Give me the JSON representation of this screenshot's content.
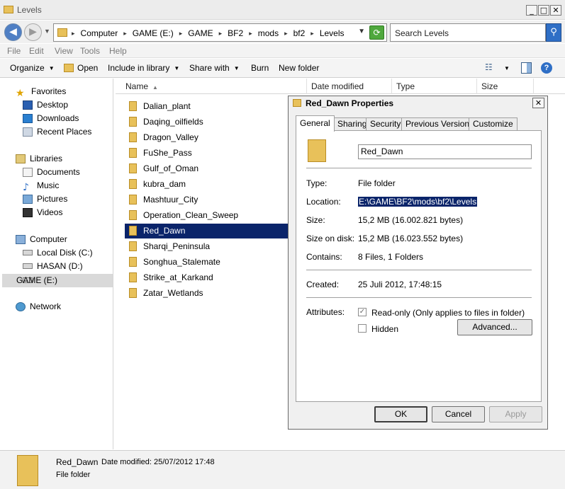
{
  "window": {
    "title": "Levels",
    "controls": {
      "minimize": "_",
      "maximize": "□",
      "close": "✕"
    }
  },
  "address": {
    "crumbs": [
      "Computer",
      "GAME (E:)",
      "GAME",
      "BF2",
      "mods",
      "bf2",
      "Levels"
    ],
    "search_placeholder": "Search Levels"
  },
  "menu": [
    "File",
    "Edit",
    "View",
    "Tools",
    "Help"
  ],
  "toolbar": {
    "organize": "Organize",
    "open": "Open",
    "include_in_library": "Include in library",
    "share_with": "Share with",
    "burn": "Burn",
    "new_folder": "New folder"
  },
  "nav": {
    "favorites": "Favorites",
    "desktop": "Desktop",
    "downloads": "Downloads",
    "recent_places": "Recent Places",
    "libraries": "Libraries",
    "documents": "Documents",
    "music": "Music",
    "pictures": "Pictures",
    "videos": "Videos",
    "computer": "Computer",
    "local_disk": "Local Disk (C:)",
    "hasan": "HASAN (D:)",
    "game": "GAME (E:)",
    "network": "Network"
  },
  "columns": {
    "name": "Name",
    "date_modified": "Date modified",
    "type": "Type",
    "size": "Size"
  },
  "files": [
    "Dalian_plant",
    "Daqing_oilfields",
    "Dragon_Valley",
    "FuShe_Pass",
    "Gulf_of_Oman",
    "kubra_dam",
    "Mashtuur_City",
    "Operation_Clean_Sweep",
    "Red_Dawn",
    "Sharqi_Peninsula",
    "Songhua_Stalemate",
    "Strike_at_Karkand",
    "Zatar_Wetlands"
  ],
  "selected_file": "Red_Dawn",
  "details": {
    "name": "Red_Dawn",
    "date_modified": "Date modified: 25/07/2012 17:48",
    "type": "File folder"
  },
  "dialog": {
    "title": "Red_Dawn Properties",
    "tabs": [
      "General",
      "Sharing",
      "Security",
      "Previous Versions",
      "Customize"
    ],
    "active_tab": "General",
    "folder_name": "Red_Dawn",
    "type_label": "Type:",
    "type_value": "File folder",
    "location_label": "Location:",
    "location_value": "E:\\GAME\\BF2\\mods\\bf2\\Levels",
    "size_label": "Size:",
    "size_value": "15,2 MB (16.002.821 bytes)",
    "size_on_disk_label": "Size on disk:",
    "size_on_disk_value": "15,2 MB (16.023.552 bytes)",
    "contains_label": "Contains:",
    "contains_value": "8 Files, 1 Folders",
    "created_label": "Created:",
    "created_value": "25 Juli 2012, 17:48:15",
    "attributes_label": "Attributes:",
    "readonly_label": "Read-only (Only applies to files in folder)",
    "readonly_checked": true,
    "hidden_label": "Hidden",
    "hidden_checked": false,
    "advanced": "Advanced...",
    "ok": "OK",
    "cancel": "Cancel",
    "apply": "Apply"
  }
}
